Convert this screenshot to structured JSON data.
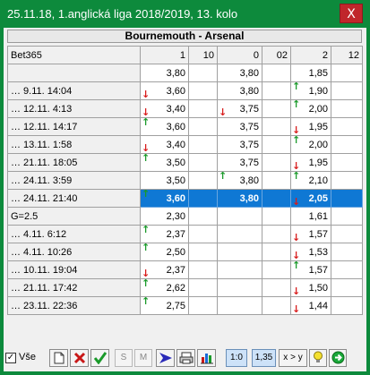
{
  "window": {
    "title": "25.11.18, 1.anglická liga 2018/2019, 13. kolo",
    "close_label": "X"
  },
  "match": {
    "title": "Bournemouth - Arsenal"
  },
  "grid": {
    "header": {
      "label": "Bet365",
      "cols": [
        "1",
        "10",
        "0",
        "02",
        "2",
        "12"
      ]
    },
    "rows": [
      {
        "label": "",
        "v1": "3,80",
        "a1": "",
        "v0": "3,80",
        "a0": "",
        "v2": "1,85",
        "a2": "",
        "selected": false
      },
      {
        "label": "… 9.11. 14:04",
        "v1": "3,60",
        "a1": "down",
        "v0": "3,80",
        "a0": "",
        "v2": "1,90",
        "a2": "up",
        "selected": false
      },
      {
        "label": "… 12.11. 4:13",
        "v1": "3,40",
        "a1": "down",
        "v0": "3,75",
        "a0": "down",
        "v2": "2,00",
        "a2": "up",
        "selected": false
      },
      {
        "label": "… 12.11. 14:17",
        "v1": "3,60",
        "a1": "up",
        "v0": "3,75",
        "a0": "",
        "v2": "1,95",
        "a2": "down",
        "selected": false
      },
      {
        "label": "… 13.11. 1:58",
        "v1": "3,40",
        "a1": "down",
        "v0": "3,75",
        "a0": "",
        "v2": "2,00",
        "a2": "up",
        "selected": false
      },
      {
        "label": "… 21.11. 18:05",
        "v1": "3,50",
        "a1": "up",
        "v0": "3,75",
        "a0": "",
        "v2": "1,95",
        "a2": "down",
        "selected": false
      },
      {
        "label": "… 24.11. 3:59",
        "v1": "3,50",
        "a1": "",
        "v0": "3,80",
        "a0": "up",
        "v2": "2,10",
        "a2": "up",
        "selected": false
      },
      {
        "label": "… 24.11. 21:40",
        "v1": "3,60",
        "a1": "up",
        "v0": "3,80",
        "a0": "",
        "v2": "2,05",
        "a2": "down",
        "selected": true
      },
      {
        "label": "G=2.5",
        "v1": "2,30",
        "a1": "",
        "v0": "",
        "a0": "",
        "v2": "1,61",
        "a2": "",
        "selected": false
      },
      {
        "label": "… 4.11. 6:12",
        "v1": "2,37",
        "a1": "up",
        "v0": "",
        "a0": "",
        "v2": "1,57",
        "a2": "down",
        "selected": false
      },
      {
        "label": "… 4.11. 10:26",
        "v1": "2,50",
        "a1": "up",
        "v0": "",
        "a0": "",
        "v2": "1,53",
        "a2": "down",
        "selected": false
      },
      {
        "label": "… 10.11. 19:04",
        "v1": "2,37",
        "a1": "down",
        "v0": "",
        "a0": "",
        "v2": "1,57",
        "a2": "up",
        "selected": false
      },
      {
        "label": "… 21.11. 17:42",
        "v1": "2,62",
        "a1": "up",
        "v0": "",
        "a0": "",
        "v2": "1,50",
        "a2": "down",
        "selected": false
      },
      {
        "label": "… 23.11. 22:36",
        "v1": "2,75",
        "a1": "up",
        "v0": "",
        "a0": "",
        "v2": "1,44",
        "a2": "down",
        "selected": false
      }
    ]
  },
  "toolbar": {
    "all_label": "Vše",
    "all_checked": true,
    "s_label": "S",
    "m_label": "M",
    "ratio_label": "1:0",
    "odds_label": "1,35",
    "xy_label": "x > y"
  }
}
